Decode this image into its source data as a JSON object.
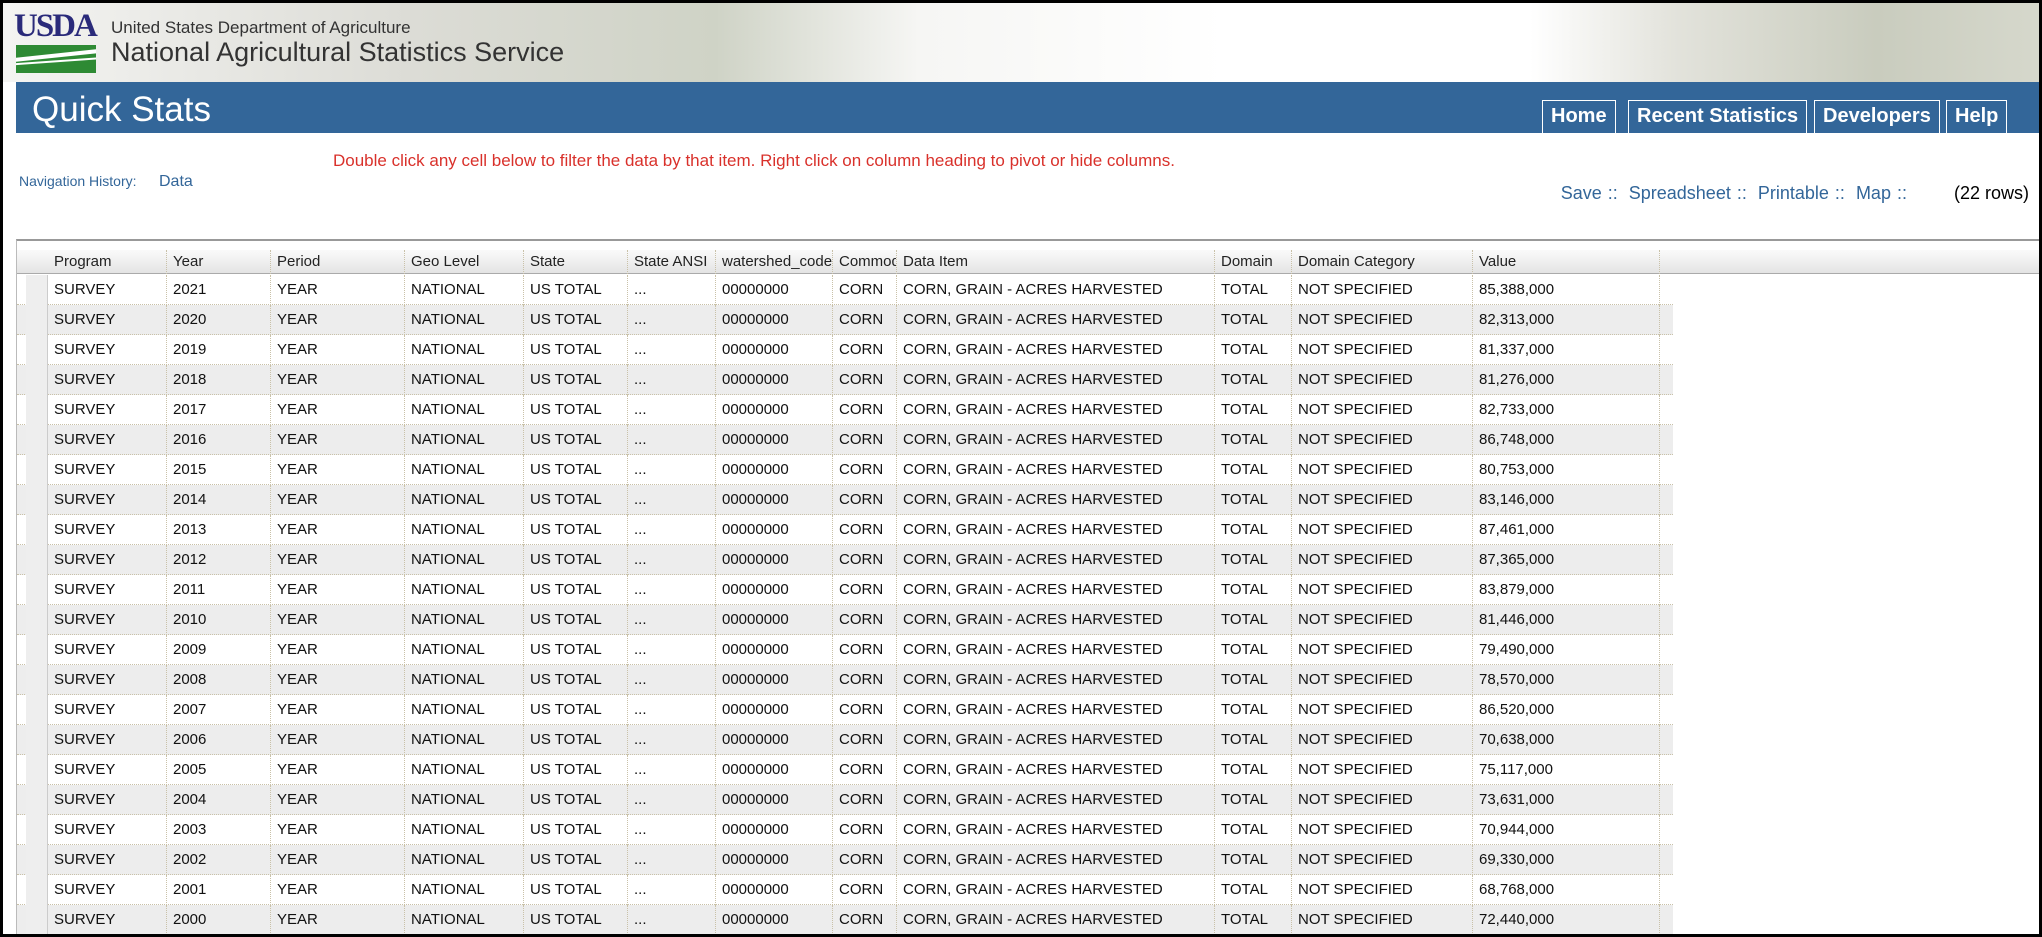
{
  "header": {
    "logo_text": "USDA",
    "department": "United States Department of Agriculture",
    "service": "National Agricultural Statistics Service"
  },
  "app_title": "Quick Stats",
  "nav_tabs": [
    "Home",
    "Recent Statistics",
    "Developers",
    "Help"
  ],
  "instruction": "Double click any cell below to filter the data by that item. Right click on column heading to pivot or hide columns.",
  "navigation_history": {
    "label": "Navigation History:",
    "item": "Data"
  },
  "actions": {
    "save": "Save",
    "spreadsheet": "Spreadsheet",
    "printable": "Printable",
    "map": "Map",
    "separator": "::",
    "row_count": "(22 rows)"
  },
  "columns": [
    "Program",
    "Year",
    "Period",
    "Geo Level",
    "State",
    "State ANSI",
    "watershed_code",
    "Commodity",
    "Data Item",
    "Domain",
    "Domain Category",
    "Value"
  ],
  "rows": [
    [
      "SURVEY",
      "2021",
      "YEAR",
      "NATIONAL",
      "US TOTAL",
      "...",
      "00000000",
      "CORN",
      "CORN, GRAIN - ACRES HARVESTED",
      "TOTAL",
      "NOT SPECIFIED",
      "85,388,000"
    ],
    [
      "SURVEY",
      "2020",
      "YEAR",
      "NATIONAL",
      "US TOTAL",
      "...",
      "00000000",
      "CORN",
      "CORN, GRAIN - ACRES HARVESTED",
      "TOTAL",
      "NOT SPECIFIED",
      "82,313,000"
    ],
    [
      "SURVEY",
      "2019",
      "YEAR",
      "NATIONAL",
      "US TOTAL",
      "...",
      "00000000",
      "CORN",
      "CORN, GRAIN - ACRES HARVESTED",
      "TOTAL",
      "NOT SPECIFIED",
      "81,337,000"
    ],
    [
      "SURVEY",
      "2018",
      "YEAR",
      "NATIONAL",
      "US TOTAL",
      "...",
      "00000000",
      "CORN",
      "CORN, GRAIN - ACRES HARVESTED",
      "TOTAL",
      "NOT SPECIFIED",
      "81,276,000"
    ],
    [
      "SURVEY",
      "2017",
      "YEAR",
      "NATIONAL",
      "US TOTAL",
      "...",
      "00000000",
      "CORN",
      "CORN, GRAIN - ACRES HARVESTED",
      "TOTAL",
      "NOT SPECIFIED",
      "82,733,000"
    ],
    [
      "SURVEY",
      "2016",
      "YEAR",
      "NATIONAL",
      "US TOTAL",
      "...",
      "00000000",
      "CORN",
      "CORN, GRAIN - ACRES HARVESTED",
      "TOTAL",
      "NOT SPECIFIED",
      "86,748,000"
    ],
    [
      "SURVEY",
      "2015",
      "YEAR",
      "NATIONAL",
      "US TOTAL",
      "...",
      "00000000",
      "CORN",
      "CORN, GRAIN - ACRES HARVESTED",
      "TOTAL",
      "NOT SPECIFIED",
      "80,753,000"
    ],
    [
      "SURVEY",
      "2014",
      "YEAR",
      "NATIONAL",
      "US TOTAL",
      "...",
      "00000000",
      "CORN",
      "CORN, GRAIN - ACRES HARVESTED",
      "TOTAL",
      "NOT SPECIFIED",
      "83,146,000"
    ],
    [
      "SURVEY",
      "2013",
      "YEAR",
      "NATIONAL",
      "US TOTAL",
      "...",
      "00000000",
      "CORN",
      "CORN, GRAIN - ACRES HARVESTED",
      "TOTAL",
      "NOT SPECIFIED",
      "87,461,000"
    ],
    [
      "SURVEY",
      "2012",
      "YEAR",
      "NATIONAL",
      "US TOTAL",
      "...",
      "00000000",
      "CORN",
      "CORN, GRAIN - ACRES HARVESTED",
      "TOTAL",
      "NOT SPECIFIED",
      "87,365,000"
    ],
    [
      "SURVEY",
      "2011",
      "YEAR",
      "NATIONAL",
      "US TOTAL",
      "...",
      "00000000",
      "CORN",
      "CORN, GRAIN - ACRES HARVESTED",
      "TOTAL",
      "NOT SPECIFIED",
      "83,879,000"
    ],
    [
      "SURVEY",
      "2010",
      "YEAR",
      "NATIONAL",
      "US TOTAL",
      "...",
      "00000000",
      "CORN",
      "CORN, GRAIN - ACRES HARVESTED",
      "TOTAL",
      "NOT SPECIFIED",
      "81,446,000"
    ],
    [
      "SURVEY",
      "2009",
      "YEAR",
      "NATIONAL",
      "US TOTAL",
      "...",
      "00000000",
      "CORN",
      "CORN, GRAIN - ACRES HARVESTED",
      "TOTAL",
      "NOT SPECIFIED",
      "79,490,000"
    ],
    [
      "SURVEY",
      "2008",
      "YEAR",
      "NATIONAL",
      "US TOTAL",
      "...",
      "00000000",
      "CORN",
      "CORN, GRAIN - ACRES HARVESTED",
      "TOTAL",
      "NOT SPECIFIED",
      "78,570,000"
    ],
    [
      "SURVEY",
      "2007",
      "YEAR",
      "NATIONAL",
      "US TOTAL",
      "...",
      "00000000",
      "CORN",
      "CORN, GRAIN - ACRES HARVESTED",
      "TOTAL",
      "NOT SPECIFIED",
      "86,520,000"
    ],
    [
      "SURVEY",
      "2006",
      "YEAR",
      "NATIONAL",
      "US TOTAL",
      "...",
      "00000000",
      "CORN",
      "CORN, GRAIN - ACRES HARVESTED",
      "TOTAL",
      "NOT SPECIFIED",
      "70,638,000"
    ],
    [
      "SURVEY",
      "2005",
      "YEAR",
      "NATIONAL",
      "US TOTAL",
      "...",
      "00000000",
      "CORN",
      "CORN, GRAIN - ACRES HARVESTED",
      "TOTAL",
      "NOT SPECIFIED",
      "75,117,000"
    ],
    [
      "SURVEY",
      "2004",
      "YEAR",
      "NATIONAL",
      "US TOTAL",
      "...",
      "00000000",
      "CORN",
      "CORN, GRAIN - ACRES HARVESTED",
      "TOTAL",
      "NOT SPECIFIED",
      "73,631,000"
    ],
    [
      "SURVEY",
      "2003",
      "YEAR",
      "NATIONAL",
      "US TOTAL",
      "...",
      "00000000",
      "CORN",
      "CORN, GRAIN - ACRES HARVESTED",
      "TOTAL",
      "NOT SPECIFIED",
      "70,944,000"
    ],
    [
      "SURVEY",
      "2002",
      "YEAR",
      "NATIONAL",
      "US TOTAL",
      "...",
      "00000000",
      "CORN",
      "CORN, GRAIN - ACRES HARVESTED",
      "TOTAL",
      "NOT SPECIFIED",
      "69,330,000"
    ],
    [
      "SURVEY",
      "2001",
      "YEAR",
      "NATIONAL",
      "US TOTAL",
      "...",
      "00000000",
      "CORN",
      "CORN, GRAIN - ACRES HARVESTED",
      "TOTAL",
      "NOT SPECIFIED",
      "68,768,000"
    ],
    [
      "SURVEY",
      "2000",
      "YEAR",
      "NATIONAL",
      "US TOTAL",
      "...",
      "00000000",
      "CORN",
      "CORN, GRAIN - ACRES HARVESTED",
      "TOTAL",
      "NOT SPECIFIED",
      "72,440,000"
    ]
  ]
}
